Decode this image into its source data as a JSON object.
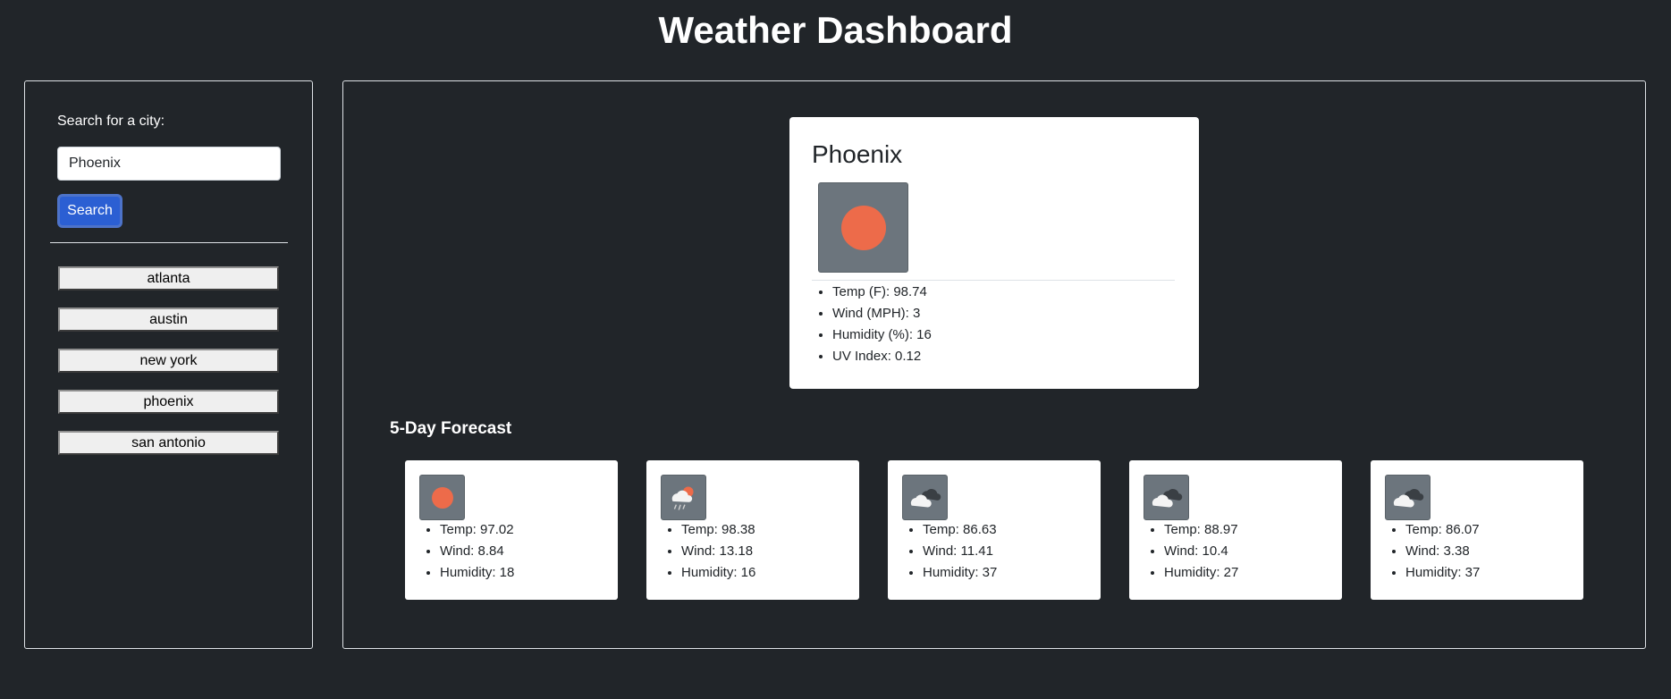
{
  "header": {
    "title": "Weather Dashboard"
  },
  "sidebar": {
    "search_label": "Search for a city:",
    "search_value": "Phoenix",
    "search_button_label": "Search",
    "history": [
      "atlanta",
      "austin",
      "new york",
      "phoenix",
      "san antonio"
    ]
  },
  "current": {
    "city": "Phoenix",
    "icon": "sun-icon",
    "stats": [
      "Temp (F): 98.74",
      "Wind (MPH): 3",
      "Humidity (%): 16",
      "UV Index: 0.12"
    ]
  },
  "forecast": {
    "title": "5-Day Forecast",
    "days": [
      {
        "icon": "sun-icon",
        "temp": "Temp: 97.02",
        "wind": "Wind: 8.84",
        "humidity": "Humidity: 18"
      },
      {
        "icon": "rain-sun-icon",
        "temp": "Temp: 98.38",
        "wind": "Wind: 13.18",
        "humidity": "Humidity: 16"
      },
      {
        "icon": "clouds-icon",
        "temp": "Temp: 86.63",
        "wind": "Wind: 11.41",
        "humidity": "Humidity: 37"
      },
      {
        "icon": "clouds-icon",
        "temp": "Temp: 88.97",
        "wind": "Wind: 10.4",
        "humidity": "Humidity: 27"
      },
      {
        "icon": "clouds-icon",
        "temp": "Temp: 86.07",
        "wind": "Wind: 3.38",
        "humidity": "Humidity: 37"
      }
    ]
  },
  "colors": {
    "background": "#212529",
    "accent": "#2b5fd3",
    "sun": "#ed6b4a",
    "icon_box": "#6c757d"
  }
}
